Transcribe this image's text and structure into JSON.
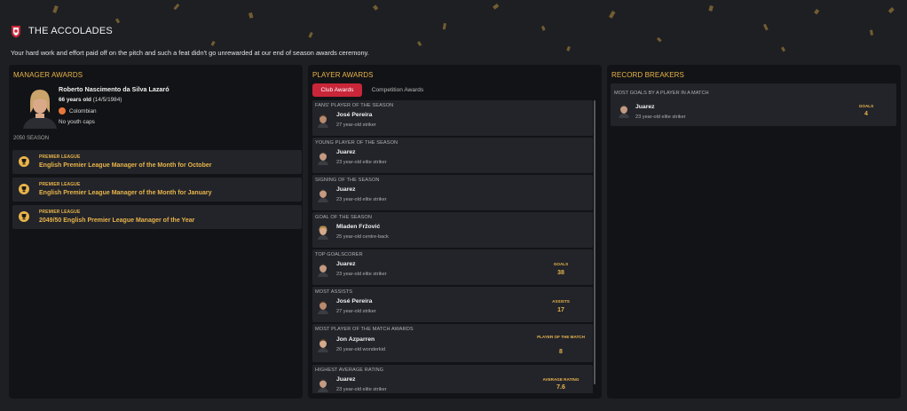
{
  "header": {
    "title": "THE ACCOLADES",
    "subtitle": "Your hard work and effort paid off on the pitch and such a feat didn't go unrewarded at our end of season awards ceremony."
  },
  "colors": {
    "accent": "#e9b44a",
    "tab_active": "#c9263a",
    "panel": "#121316",
    "card": "#22242a",
    "background": "#1e1f23"
  },
  "manager": {
    "section_title": "MANAGER AWARDS",
    "name": "Roberto Nascimento da Silva Lazaró",
    "age": "66 years old",
    "dob": "(14/5/1984)",
    "nationality": "Colombian",
    "youth_caps": "No youth caps",
    "season": "2050 SEASON",
    "awards": [
      {
        "league": "PREMIER LEAGUE",
        "title": "English Premier League Manager of the Month for October",
        "icon": "trophy-icon"
      },
      {
        "league": "PREMIER LEAGUE",
        "title": "English Premier League Manager of the Month for January",
        "icon": "trophy-icon"
      },
      {
        "league": "PREMIER LEAGUE",
        "title": "2049/50 English Premier League Manager of the Year",
        "icon": "trophy-icon"
      }
    ]
  },
  "player_awards": {
    "section_title": "PLAYER AWARDS",
    "tabs": [
      {
        "label": "Club Awards"
      },
      {
        "label": "Competition Awards"
      }
    ],
    "items": [
      {
        "category": "FANS' PLAYER OF THE SEASON",
        "name": "José Pereira",
        "desc": "27 year-old striker",
        "stat_label": "",
        "stat_value": ""
      },
      {
        "category": "YOUNG PLAYER OF THE SEASON",
        "name": "Juarez",
        "desc": "23 year-old elite striker",
        "stat_label": "",
        "stat_value": ""
      },
      {
        "category": "SIGNING OF THE SEASON",
        "name": "Juarez",
        "desc": "23 year-old elite striker",
        "stat_label": "",
        "stat_value": ""
      },
      {
        "category": "GOAL OF THE SEASON",
        "name": "Mladen Fržović",
        "desc": "25 year-old centre-back",
        "stat_label": "",
        "stat_value": ""
      },
      {
        "category": "TOP GOALSCORER",
        "name": "Juarez",
        "desc": "23 year-old elite striker",
        "stat_label": "GOALS",
        "stat_value": "38"
      },
      {
        "category": "MOST ASSISTS",
        "name": "José Pereira",
        "desc": "27 year-old striker",
        "stat_label": "ASSISTS",
        "stat_value": "17"
      },
      {
        "category": "MOST PLAYER OF THE MATCH AWARDS",
        "name": "Jon Azparren",
        "desc": "20 year-old wonderkid",
        "stat_label": "PLAYER OF THE MATCH",
        "stat_value": "8"
      },
      {
        "category": "HIGHEST AVERAGE RATING",
        "name": "Juarez",
        "desc": "23 year-old elite striker",
        "stat_label": "AVERAGE RATING",
        "stat_value": "7.6"
      }
    ]
  },
  "record_breakers": {
    "section_title": "RECORD BREAKERS",
    "items": [
      {
        "category": "MOST GOALS BY A PLAYER IN A MATCH",
        "name": "Juarez",
        "desc": "23 year-old elite striker",
        "stat_label": "GOALS",
        "stat_value": "4"
      }
    ]
  }
}
